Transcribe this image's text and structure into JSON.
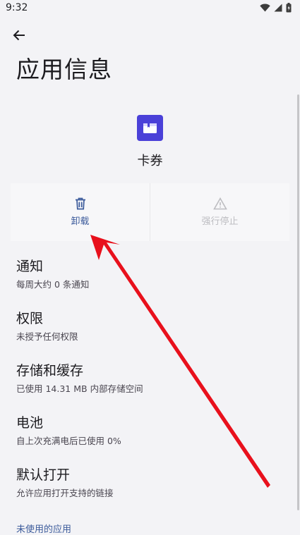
{
  "status_bar": {
    "time": "9:32",
    "icons": [
      "wifi-icon",
      "signal-icon",
      "battery-icon"
    ]
  },
  "header": {
    "back_icon": "arrow-left-icon",
    "title": "应用信息"
  },
  "app": {
    "name": "卡券",
    "icon": "ticket-icon",
    "icon_color": "#4a40d8"
  },
  "actions": {
    "uninstall": {
      "label": "卸载",
      "icon": "trash-icon",
      "enabled": true
    },
    "force_stop": {
      "label": "强行停止",
      "icon": "warning-triangle-icon",
      "enabled": false
    }
  },
  "settings": [
    {
      "title": "通知",
      "subtitle": "每周大约 0 条通知"
    },
    {
      "title": "权限",
      "subtitle": "未授予任何权限"
    },
    {
      "title": "存储和缓存",
      "subtitle": "已使用 14.31 MB 内部存储空间"
    },
    {
      "title": "电池",
      "subtitle": "自上次充满电后已使用 0%"
    },
    {
      "title": "默认打开",
      "subtitle": "允许应用打开支持的链接"
    }
  ],
  "section": {
    "unused_apps": "未使用的应用"
  },
  "colors": {
    "accent": "#3c5b9b",
    "annotation_arrow": "#e8101c",
    "background": "#f3f3f6"
  }
}
